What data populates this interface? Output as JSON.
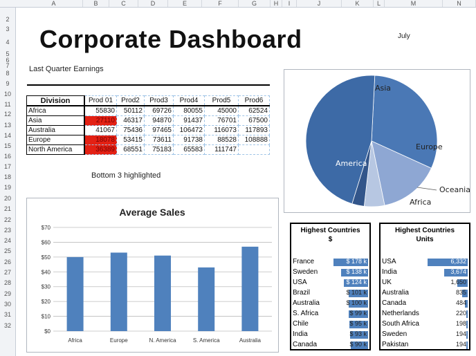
{
  "sheet": {
    "columns": [
      "A",
      "B",
      "C",
      "D",
      "E",
      "F",
      "G",
      "H",
      "I",
      "J",
      "K",
      "L",
      "M",
      "N"
    ],
    "rows": [
      "2",
      "3",
      "4",
      "5",
      "6",
      "7",
      "8",
      "9",
      "10",
      "11",
      "12",
      "13",
      "14",
      "15",
      "16",
      "17",
      "18",
      "19",
      "20",
      "21",
      "22",
      "23",
      "24",
      "25",
      "26",
      "27",
      "28",
      "29",
      "30",
      "31",
      "32"
    ]
  },
  "title": "Corporate Dashboard",
  "month": "July",
  "section_label": "Last Quarter Earnings",
  "table": {
    "header": [
      "Division",
      "Prod 01",
      "Prod2",
      "Prod3",
      "Prod4",
      "Prod5",
      "Prod6"
    ],
    "rows": [
      {
        "division": "Africa",
        "values": [
          "55830",
          "50112",
          "69726",
          "80055",
          "45000",
          "62524"
        ]
      },
      {
        "division": "Asia",
        "values": [
          "27110",
          "46317",
          "94870",
          "91437",
          "76701",
          "67500"
        ]
      },
      {
        "division": "Australia",
        "values": [
          "41067",
          "75436",
          "97465",
          "106472",
          "116073",
          "117893"
        ]
      },
      {
        "division": "Europe",
        "values": [
          "18078",
          "53415",
          "73611",
          "91738",
          "88528",
          "108888"
        ]
      },
      {
        "division": "North America",
        "values": [
          "36389",
          "68551",
          "75183",
          "65583",
          "111747",
          ""
        ]
      }
    ]
  },
  "highlight_note": "Bottom 3 highlighted",
  "colors": {
    "bar": "#4f81bd",
    "highlight": "#e32114"
  },
  "chart_data": [
    {
      "type": "pie",
      "categories": [
        "Asia",
        "Europe",
        "Oceania",
        "Africa",
        "America"
      ],
      "values": [
        31,
        15,
        5,
        3,
        46
      ]
    },
    {
      "type": "bar",
      "title": "Average Sales",
      "categories": [
        "Africa",
        "Europe",
        "N. America",
        "S. America",
        "Australia"
      ],
      "values": [
        50,
        53,
        51,
        43,
        57
      ],
      "ytick_labels": [
        "$0",
        "$10",
        "$20",
        "$30",
        "$40",
        "$50",
        "$60",
        "$70"
      ],
      "ylim": [
        0,
        70
      ],
      "grid": true
    }
  ],
  "highest_dollars": {
    "title_line1": "Highest Countries",
    "title_line2": "$",
    "items": [
      {
        "country": "France",
        "value": "$ 178 k",
        "v": 178
      },
      {
        "country": "Sweden",
        "value": "$ 138 k",
        "v": 138
      },
      {
        "country": "USA",
        "value": "$ 124 k",
        "v": 124
      },
      {
        "country": "Brazil",
        "value": "$ 101 k",
        "v": 101
      },
      {
        "country": "Australia",
        "value": "$ 100 k",
        "v": 100
      },
      {
        "country": "S. Africa",
        "value": "$ 99 k",
        "v": 99
      },
      {
        "country": "Chile",
        "value": "$ 95 k",
        "v": 95
      },
      {
        "country": "India",
        "value": "$ 93 k",
        "v": 93
      },
      {
        "country": "Canada",
        "value": "$ 90 k",
        "v": 90
      }
    ]
  },
  "highest_units": {
    "title_line1": "Highest Countries",
    "title_line2": "Units",
    "items": [
      {
        "country": "USA",
        "value": "6,332",
        "v": 6332
      },
      {
        "country": "India",
        "value": "3,674",
        "v": 3674
      },
      {
        "country": "UK",
        "value": "1,650",
        "v": 1650
      },
      {
        "country": "Australia",
        "value": "835",
        "v": 835
      },
      {
        "country": "Canada",
        "value": "484",
        "v": 484
      },
      {
        "country": "Netherlands",
        "value": "220",
        "v": 220
      },
      {
        "country": "South Africa",
        "value": "198",
        "v": 198
      },
      {
        "country": "Sweden",
        "value": "194",
        "v": 194
      },
      {
        "country": "Pakistan",
        "value": "194",
        "v": 194
      }
    ]
  }
}
